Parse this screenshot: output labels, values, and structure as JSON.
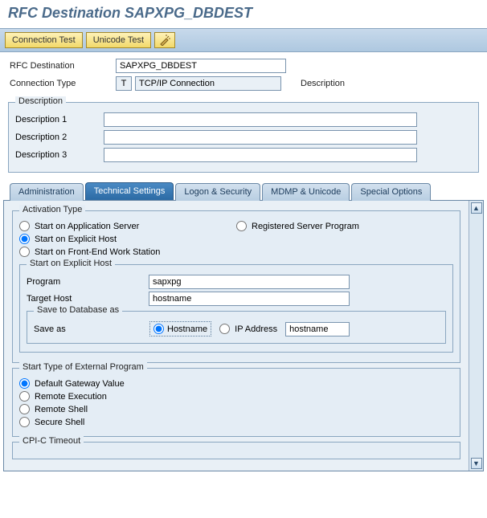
{
  "title": "RFC Destination SAPXPG_DBDEST",
  "toolbar": {
    "connection_test": "Connection Test",
    "unicode_test": "Unicode Test"
  },
  "header": {
    "rfc_dest_label": "RFC Destination",
    "rfc_dest_value": "SAPXPG_DBDEST",
    "conn_type_label": "Connection Type",
    "conn_type_code": "T",
    "conn_type_text": "TCP/IP Connection",
    "description_label": "Description"
  },
  "description_group": {
    "title": "Description",
    "d1_label": "Description 1",
    "d1_value": "",
    "d2_label": "Description 2",
    "d2_value": "",
    "d3_label": "Description 3",
    "d3_value": ""
  },
  "tabs": {
    "administration": "Administration",
    "technical": "Technical Settings",
    "logon": "Logon & Security",
    "mdmp": "MDMP & Unicode",
    "special": "Special Options"
  },
  "activation": {
    "title": "Activation Type",
    "opt_app_server": "Start on Application Server",
    "opt_registered": "Registered Server Program",
    "opt_explicit": "Start on Explicit Host",
    "opt_frontend": "Start on Front-End Work Station"
  },
  "explicit_host": {
    "title": "Start on Explicit Host",
    "program_label": "Program",
    "program_value": "sapxpg",
    "target_label": "Target Host",
    "target_value": "hostname"
  },
  "save_db": {
    "title": "Save to Database as",
    "saveas_label": "Save as",
    "hostname_label": "Hostname",
    "ip_label": "IP Address",
    "saved_value": "hostname"
  },
  "start_type": {
    "title": "Start Type of External Program",
    "opt_default": "Default Gateway Value",
    "opt_remote_exec": "Remote Execution",
    "opt_remote_shell": "Remote Shell",
    "opt_secure_shell": "Secure Shell"
  },
  "cpic": {
    "title": "CPI-C Timeout"
  }
}
